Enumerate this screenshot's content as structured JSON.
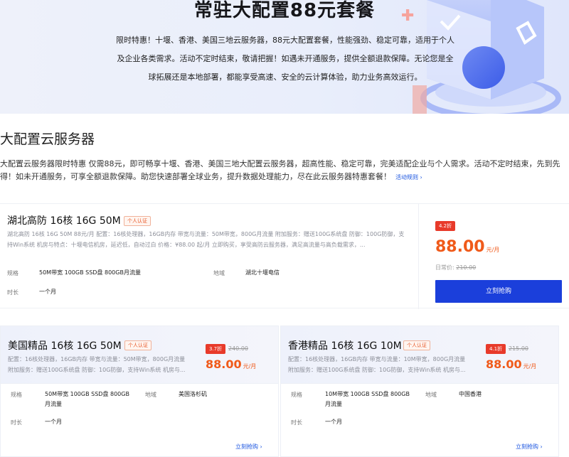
{
  "hero": {
    "title": "常驻大配置88元套餐",
    "desc": "限时特惠！十堰、香港、美国三地云服务器，88元大配置套餐，性能强劲、稳定可靠，适用于个人及企业各类需求。活动不定时结束，敬请把握！如遇未开通服务，提供全额退款保障。无论您是全球拓展还是本地部署，都能享受高速、安全的云计算体验，助力业务高效运行。"
  },
  "section": {
    "title": "大配置云服务器",
    "desc": "大配置云服务器限时特惠 仅需88元，即可畅享十堰、香港、美国三地大配置云服务器，超高性能、稳定可靠，完美适配企业与个人需求。活动不定时结束，先到先得！如未开通服务，可享全额退款保障。助您快速部署全球业务，提升数据处理能力，尽在此云服务器特惠套餐！",
    "rules_link": "活动规则 ›"
  },
  "cards": [
    {
      "name": "湖北高防 16核 16G 50M",
      "auth": "个人认证",
      "desc": "湖北高防 16核 16G 50M 88元/月 配置：16核处理器，16GB内存 带宽与流量：50M带宽，800G月流量 附加服务：赠送100G系统盘 防御：100G防御，支持Win系统 机房与特点：十堰电信机房，延迟低，自动过白 价格：¥88.00 起/月 立即购买，享受高防云服务器，满足高流量与高负载需求，...",
      "spec_label": "规格",
      "spec_value": "50M带宽 100GB SSD盘 800GB月流量",
      "region_label": "地域",
      "region_value": "湖北十堰电信",
      "duration_label": "时长",
      "duration_value": "一个月",
      "discount": "4.2折",
      "price": "88.00",
      "unit": "元/月",
      "orig_label": "日常价:",
      "orig_price": "210.00",
      "buy": "立刻抢购"
    },
    {
      "name": "美国精品 16核 16G 50M",
      "auth": "个人认证",
      "desc1": "配置：16核处理器，16GB内存 带宽与流量：50M带宽，800G月流量",
      "desc2": "附加服务：赠送100G系统盘 防御：10G防御，支持Win系统 机房与...",
      "spec_label": "规格",
      "spec_value1": "50M带宽 100GB SSD盘 800GB",
      "spec_value2": "月流量",
      "region_label": "地域",
      "region_value": "美国洛杉矶",
      "duration_label": "时长",
      "duration_value": "一个月",
      "discount": "3.7折",
      "orig_price": "240.00",
      "price": "88.00",
      "unit": "元/月",
      "buy": "立刻抢购 ›"
    },
    {
      "name": "香港精品 16核 16G 10M",
      "auth": "个人认证",
      "desc1": "配置：16核处理器，16GB内存 带宽与流量：10M带宽，800G月流量",
      "desc2": "附加服务：赠送100G系统盘 防御：10G防御，支持Win系统 机房与...",
      "spec_label": "规格",
      "spec_value1": "10M带宽 100GB SSD盘 800GB",
      "spec_value2": "月流量",
      "region_label": "地域",
      "region_value": "中国香港",
      "duration_label": "时长",
      "duration_value": "一个月",
      "discount": "4.1折",
      "orig_price": "215.00",
      "price": "88.00",
      "unit": "元/月",
      "buy": "立刻抢购 ›"
    }
  ]
}
